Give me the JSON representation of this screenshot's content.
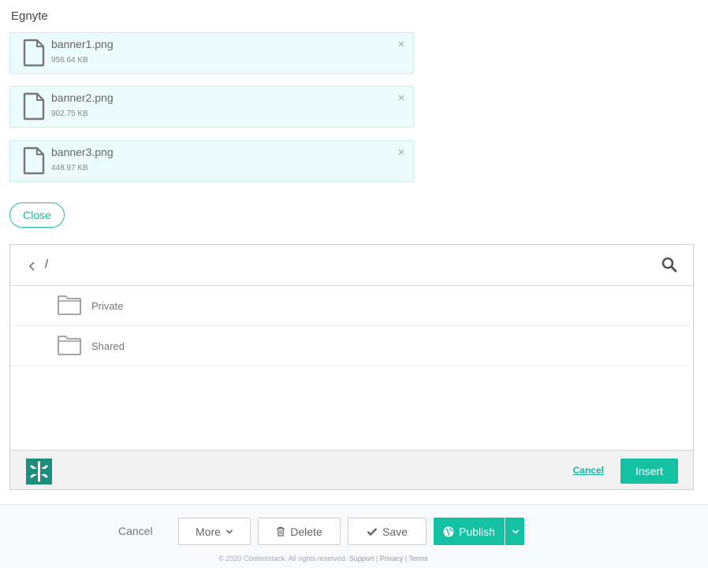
{
  "field": {
    "label": "Egnyte"
  },
  "files": [
    {
      "name": "banner1.png",
      "size": "956.64 KB"
    },
    {
      "name": "banner2.png",
      "size": "902.75 KB"
    },
    {
      "name": "banner3.png",
      "size": "448.97 KB"
    }
  ],
  "close_label": "Close",
  "browser": {
    "path": "/",
    "folders": [
      {
        "label": "Private"
      },
      {
        "label": "Shared"
      }
    ],
    "cancel_label": "Cancel",
    "insert_label": "Insert"
  },
  "actions": {
    "cancel": "Cancel",
    "more": "More",
    "delete": "Delete",
    "save": "Save",
    "publish": "Publish"
  },
  "footer": {
    "copyright": "© 2020 Contentstack. All rights reserved.",
    "support": "Support",
    "privacy": "Privacy",
    "terms": "Terms",
    "separator": "|"
  },
  "colors": {
    "accent": "#14c2a3",
    "file_bg": "#ecfcfd",
    "egnyte_brand": "#1c8e7c"
  },
  "icons": {
    "file": "file-icon",
    "remove": "close-icon",
    "back": "chevron-left-icon",
    "search": "search-icon",
    "folder": "folder-icon",
    "logo": "egnyte-logo-icon",
    "more": "chevron-down-icon",
    "delete": "trash-icon",
    "save": "check-icon",
    "publish": "globe-icon",
    "publish_menu": "chevron-down-icon"
  }
}
